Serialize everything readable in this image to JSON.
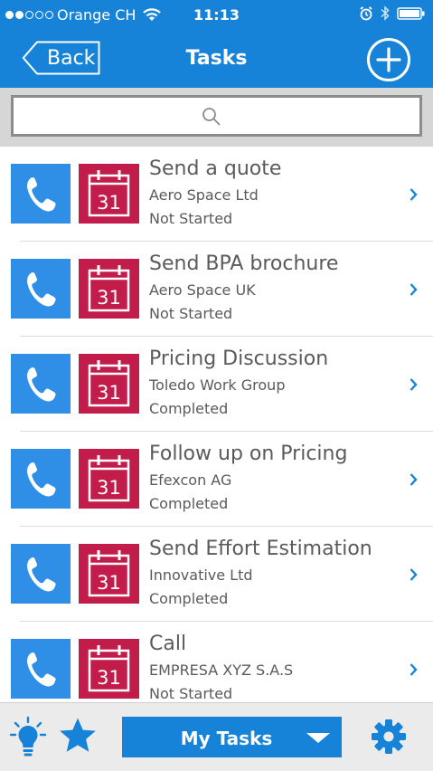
{
  "status_bar": {
    "carrier": "Orange CH",
    "time": "11:13"
  },
  "nav": {
    "back_label": "Back",
    "title": "Tasks"
  },
  "search": {
    "placeholder": ""
  },
  "tasks": [
    {
      "title": "Send a quote",
      "company": "Aero Space Ltd",
      "status": "Not Started",
      "calendar_day": "31"
    },
    {
      "title": "Send BPA brochure",
      "company": "Aero Space UK",
      "status": "Not Started",
      "calendar_day": "31"
    },
    {
      "title": "Pricing Discussion",
      "company": "Toledo Work Group",
      "status": "Completed",
      "calendar_day": "31"
    },
    {
      "title": "Follow up on Pricing",
      "company": "Efexcon AG",
      "status": "Completed",
      "calendar_day": "31"
    },
    {
      "title": "Send Effort Estimation",
      "company": "Innovative Ltd",
      "status": "Completed",
      "calendar_day": "31"
    },
    {
      "title": "Call",
      "company": "EMPRESA XYZ S.A.S",
      "status": "Not Started",
      "calendar_day": "31"
    }
  ],
  "bottom_bar": {
    "filter_label": "My Tasks"
  },
  "colors": {
    "header_blue": "#1683d8",
    "phone_tile_blue": "#2f8fe6",
    "calendar_tile_red": "#c11c4a",
    "text_gray": "#5a5a5a"
  },
  "icons": {
    "nav": [
      "back-icon",
      "add-icon"
    ],
    "row": [
      "phone-icon",
      "calendar-icon",
      "chevron-right-icon"
    ],
    "bottom": [
      "lightbulb-icon",
      "star-icon",
      "dropdown-icon",
      "gear-icon"
    ]
  }
}
